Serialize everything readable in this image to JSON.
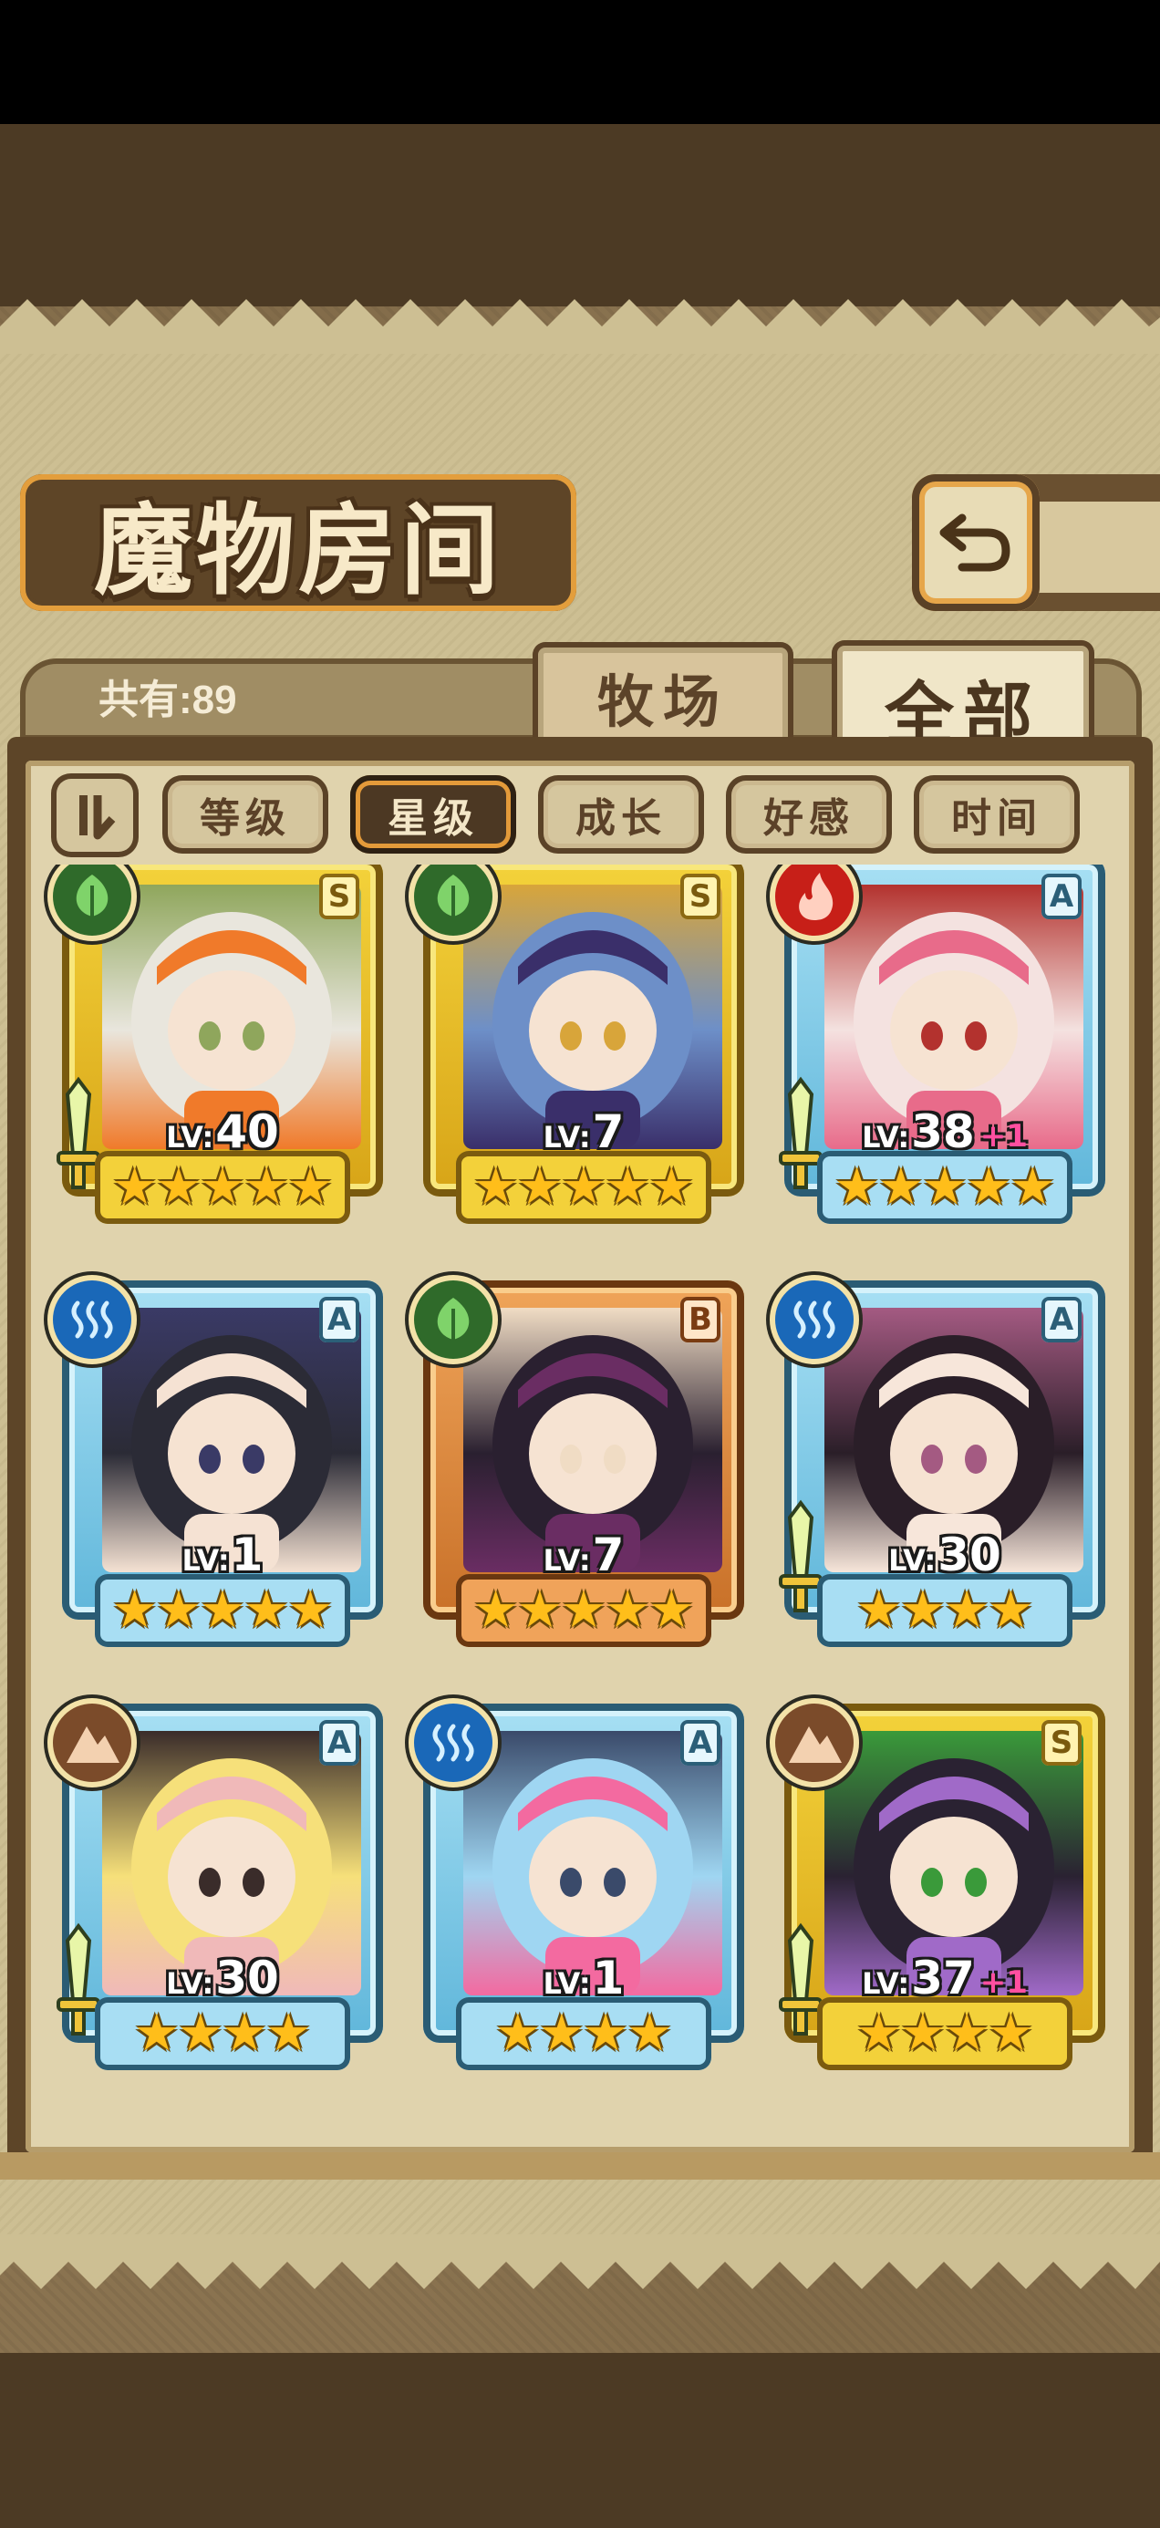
{
  "screen": {
    "title": "魔物房间",
    "count_label": "共有:89",
    "back_button": "back-arrow-icon"
  },
  "tabs": [
    {
      "label": "牧场",
      "active": false
    },
    {
      "label": "全部",
      "active": true
    }
  ],
  "sort": {
    "toggle_icon": "sort-order-icon",
    "buttons": [
      {
        "label": "等级",
        "active": false
      },
      {
        "label": "星级",
        "active": true
      },
      {
        "label": "成长",
        "active": false
      },
      {
        "label": "好感",
        "active": false
      },
      {
        "label": "时间",
        "active": false
      }
    ]
  },
  "monsters": [
    {
      "rank": "S",
      "element": "nature",
      "frame": "gold",
      "lv_prefix": "LV:",
      "level": "40",
      "bonus": "",
      "stars": 5,
      "sword": true,
      "portrait_colors": [
        "#e9e6dd",
        "#f07a2a",
        "#8fa65c"
      ]
    },
    {
      "rank": "S",
      "element": "nature",
      "frame": "gold",
      "lv_prefix": "LV:",
      "level": "7",
      "bonus": "",
      "stars": 5,
      "sword": false,
      "portrait_colors": [
        "#6d8fc8",
        "#3a2f6a",
        "#d8a53a"
      ]
    },
    {
      "rank": "A",
      "element": "fire",
      "frame": "blue",
      "lv_prefix": "LV:",
      "level": "38",
      "bonus": "+1",
      "stars": 5,
      "sword": true,
      "portrait_colors": [
        "#f4e2e0",
        "#e86b8a",
        "#b3322e"
      ]
    },
    {
      "rank": "A",
      "element": "water",
      "frame": "blue",
      "lv_prefix": "LV:",
      "level": "1",
      "bonus": "",
      "stars": 5,
      "sword": false,
      "portrait_colors": [
        "#2b2b36",
        "#f5e2d3",
        "#3a3a66"
      ]
    },
    {
      "rank": "B",
      "element": "nature",
      "frame": "bronze",
      "lv_prefix": "LV:",
      "level": "7",
      "bonus": "",
      "stars": 5,
      "sword": false,
      "portrait_colors": [
        "#2a2030",
        "#6a2d63",
        "#f0dcc4"
      ]
    },
    {
      "rank": "A",
      "element": "water",
      "frame": "blue",
      "lv_prefix": "LV:",
      "level": "30",
      "bonus": "",
      "stars": 4,
      "sword": true,
      "portrait_colors": [
        "#2a1e28",
        "#f7e6da",
        "#a45a82"
      ]
    },
    {
      "rank": "A",
      "element": "earth",
      "frame": "blue",
      "lv_prefix": "LV:",
      "level": "30",
      "bonus": "",
      "stars": 4,
      "sword": true,
      "portrait_colors": [
        "#f6e07a",
        "#f0b9b9",
        "#3a2c2a"
      ]
    },
    {
      "rank": "A",
      "element": "water",
      "frame": "blue",
      "lv_prefix": "LV:",
      "level": "1",
      "bonus": "",
      "stars": 4,
      "sword": false,
      "portrait_colors": [
        "#9fd6f2",
        "#f36aa0",
        "#3a4a6a"
      ]
    },
    {
      "rank": "S",
      "element": "earth",
      "frame": "gold",
      "lv_prefix": "LV:",
      "level": "37",
      "bonus": "+1",
      "stars": 4,
      "sword": true,
      "portrait_colors": [
        "#2a2232",
        "#a06ac8",
        "#3a9a3a"
      ]
    }
  ],
  "colors": {
    "parchment": "#cdbf93",
    "panel_border": "#5d4528",
    "accent_orange": "#e39e3c",
    "level_bonus": "#ff4fa0"
  }
}
